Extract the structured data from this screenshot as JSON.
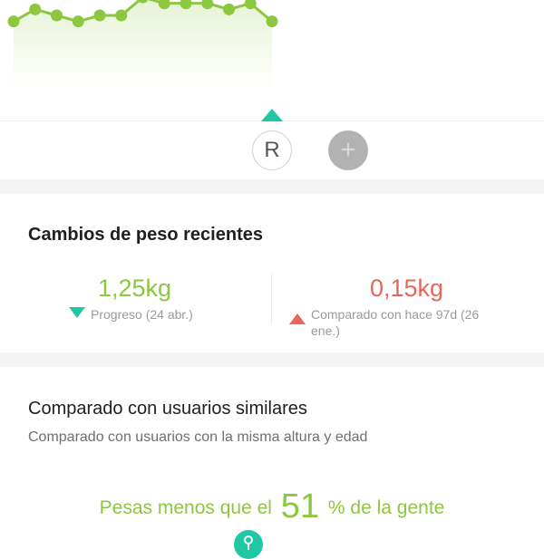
{
  "colors": {
    "accent_green": "#8dc63f",
    "accent_teal": "#1fc7a3",
    "accent_red": "#e8665a"
  },
  "chart_data": {
    "type": "line",
    "values": [
      2,
      4,
      3,
      2,
      3,
      3,
      6,
      5,
      5,
      5,
      4,
      5,
      2
    ]
  },
  "controls": {
    "avatar_letter": "R",
    "add_symbol": "+"
  },
  "recent_changes": {
    "title": "Cambios de peso recientes",
    "progress": {
      "value": "1,25kg",
      "caption": "Progreso (24 abr.)"
    },
    "comparison": {
      "value": "0,15kg",
      "caption": "Comparado con hace 97d (26 ene.)"
    }
  },
  "similar_users": {
    "title": "Comparado con usuarios similares",
    "subtitle": "Comparado con usuarios con la misma altura y edad",
    "prefix": "Pesas menos que el",
    "percent": "51",
    "suffix": "% de la gente"
  }
}
